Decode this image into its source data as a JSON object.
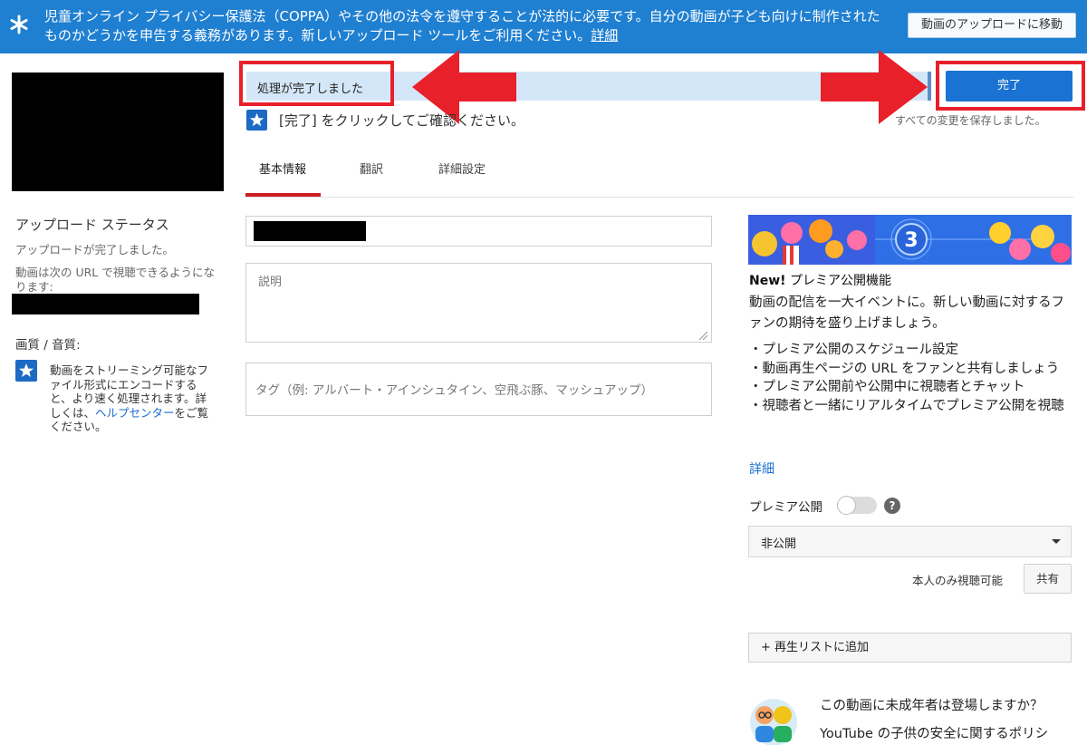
{
  "banner": {
    "text": "児童オンライン プライバシー保護法（COPPA）やその他の法令を遵守することが法的に必要です。自分の動画が子ども向けに制作されたものかどうかを申告する義務があります。新しいアップロード ツールをご利用ください。",
    "link": "詳細",
    "button": "動画のアップロードに移動",
    "icon": "asterisk-icon"
  },
  "left": {
    "upload_status_title": "アップロード ステータス",
    "upload_complete": "アップロードが完了しました。",
    "url_label": "動画は次の URL で視聴できるようになります:",
    "quality_title": "画質 / 音質:",
    "encode_text_before": "動画をストリーミング可能なファイル形式にエンコードすると、より速く処理されます。詳しくは、",
    "encode_link": "ヘルプセンター",
    "encode_text_after": "をご覧ください。"
  },
  "status": {
    "processing": "処理が完了しました",
    "done_button": "完了",
    "confirm": "[完了] をクリックしてご確認ください。",
    "saved": "すべての変更を保存しました。"
  },
  "tabs": [
    {
      "label": "基本情報",
      "active": true
    },
    {
      "label": "翻訳",
      "active": false
    },
    {
      "label": "詳細設定",
      "active": false
    }
  ],
  "form": {
    "description_placeholder": "説明",
    "tags_placeholder": "タグ（例: アルバート・アインシュタイン、空飛ぶ豚、マッシュアップ）"
  },
  "premiere": {
    "title_new": "New!",
    "title_rest": " プレミア公開機能",
    "description": "動画の配信を一大イベントに。新しい動画に対するファンの期待を盛り上げましょう。",
    "bullets": [
      "・プレミア公開のスケジュール設定",
      "・動画再生ページの URL をファンと共有しましょう",
      "・プレミア公開前や公開中に視聴者とチャット",
      "・視聴者と一緒にリアルタイムでプレミア公開を視聴"
    ],
    "more_link": "詳細",
    "toggle_label": "プレミア公開",
    "help": "?",
    "countdown": "3"
  },
  "privacy": {
    "selected": "非公開",
    "owner_only": "本人のみ視聴可能",
    "share_button": "共有"
  },
  "playlist_button": "+ 再生リストに追加",
  "kids": {
    "question": "この動画に未成年者は登場しますか？",
    "safety": "YouTube の子供の安全に関するポリシ"
  },
  "colors": {
    "banner_blue": "#1f7fd1",
    "done_blue": "#1a73d2",
    "annotation_red": "#e8202a",
    "tab_red": "#cc1e1e",
    "link_blue": "#1a6ecf"
  }
}
